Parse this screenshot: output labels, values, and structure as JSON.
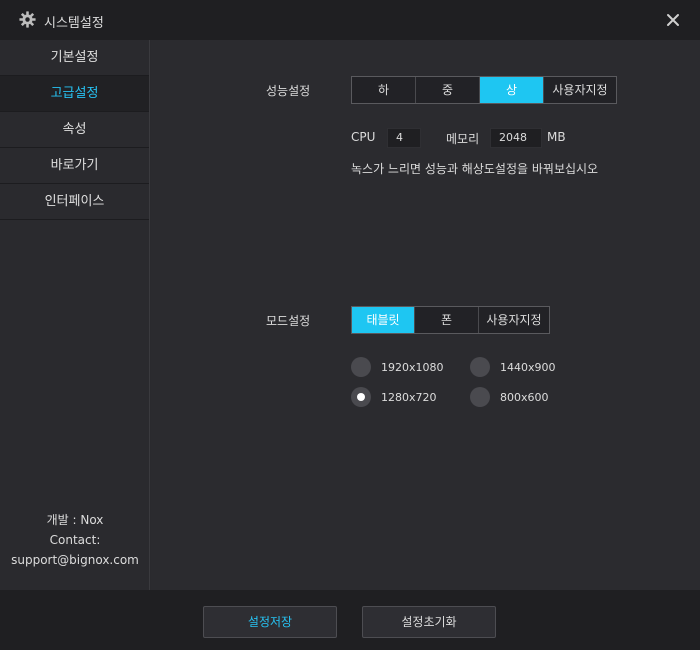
{
  "window": {
    "title": "시스템설정",
    "icon": "gear-icon",
    "close_icon": "close-icon"
  },
  "sidebar": {
    "items": [
      {
        "label": "기본설정",
        "active": false
      },
      {
        "label": "고급설정",
        "active": true
      },
      {
        "label": "속성",
        "active": false
      },
      {
        "label": "바로가기",
        "active": false
      },
      {
        "label": "인터페이스",
        "active": false
      }
    ],
    "dev_line1": "개발 : Nox",
    "dev_line2": "Contact:",
    "dev_line3": "support@bignox.com"
  },
  "performance": {
    "label": "성능설정",
    "options": [
      "하",
      "중",
      "상",
      "사용자지정"
    ],
    "selected": "상",
    "cpu_label": "CPU",
    "cpu_value": "4",
    "memory_label": "메모리",
    "memory_value": "2048",
    "memory_unit": "MB",
    "hint": "녹스가 느리면 성능과 해상도설정을 바꿔보십시오"
  },
  "mode": {
    "label": "모드설정",
    "options": [
      "태블릿",
      "폰",
      "사용자지정"
    ],
    "selected": "태블릿",
    "resolutions": [
      {
        "label": "1920x1080",
        "checked": false
      },
      {
        "label": "1440x900",
        "checked": false
      },
      {
        "label": "1280x720",
        "checked": true
      },
      {
        "label": "800x600",
        "checked": false
      }
    ]
  },
  "footer": {
    "save_label": "설정저장",
    "reset_label": "설정초기화"
  },
  "colors": {
    "accent": "#1ec6f2",
    "background": "#2a2a2e",
    "titlebar": "#1f1f22"
  }
}
